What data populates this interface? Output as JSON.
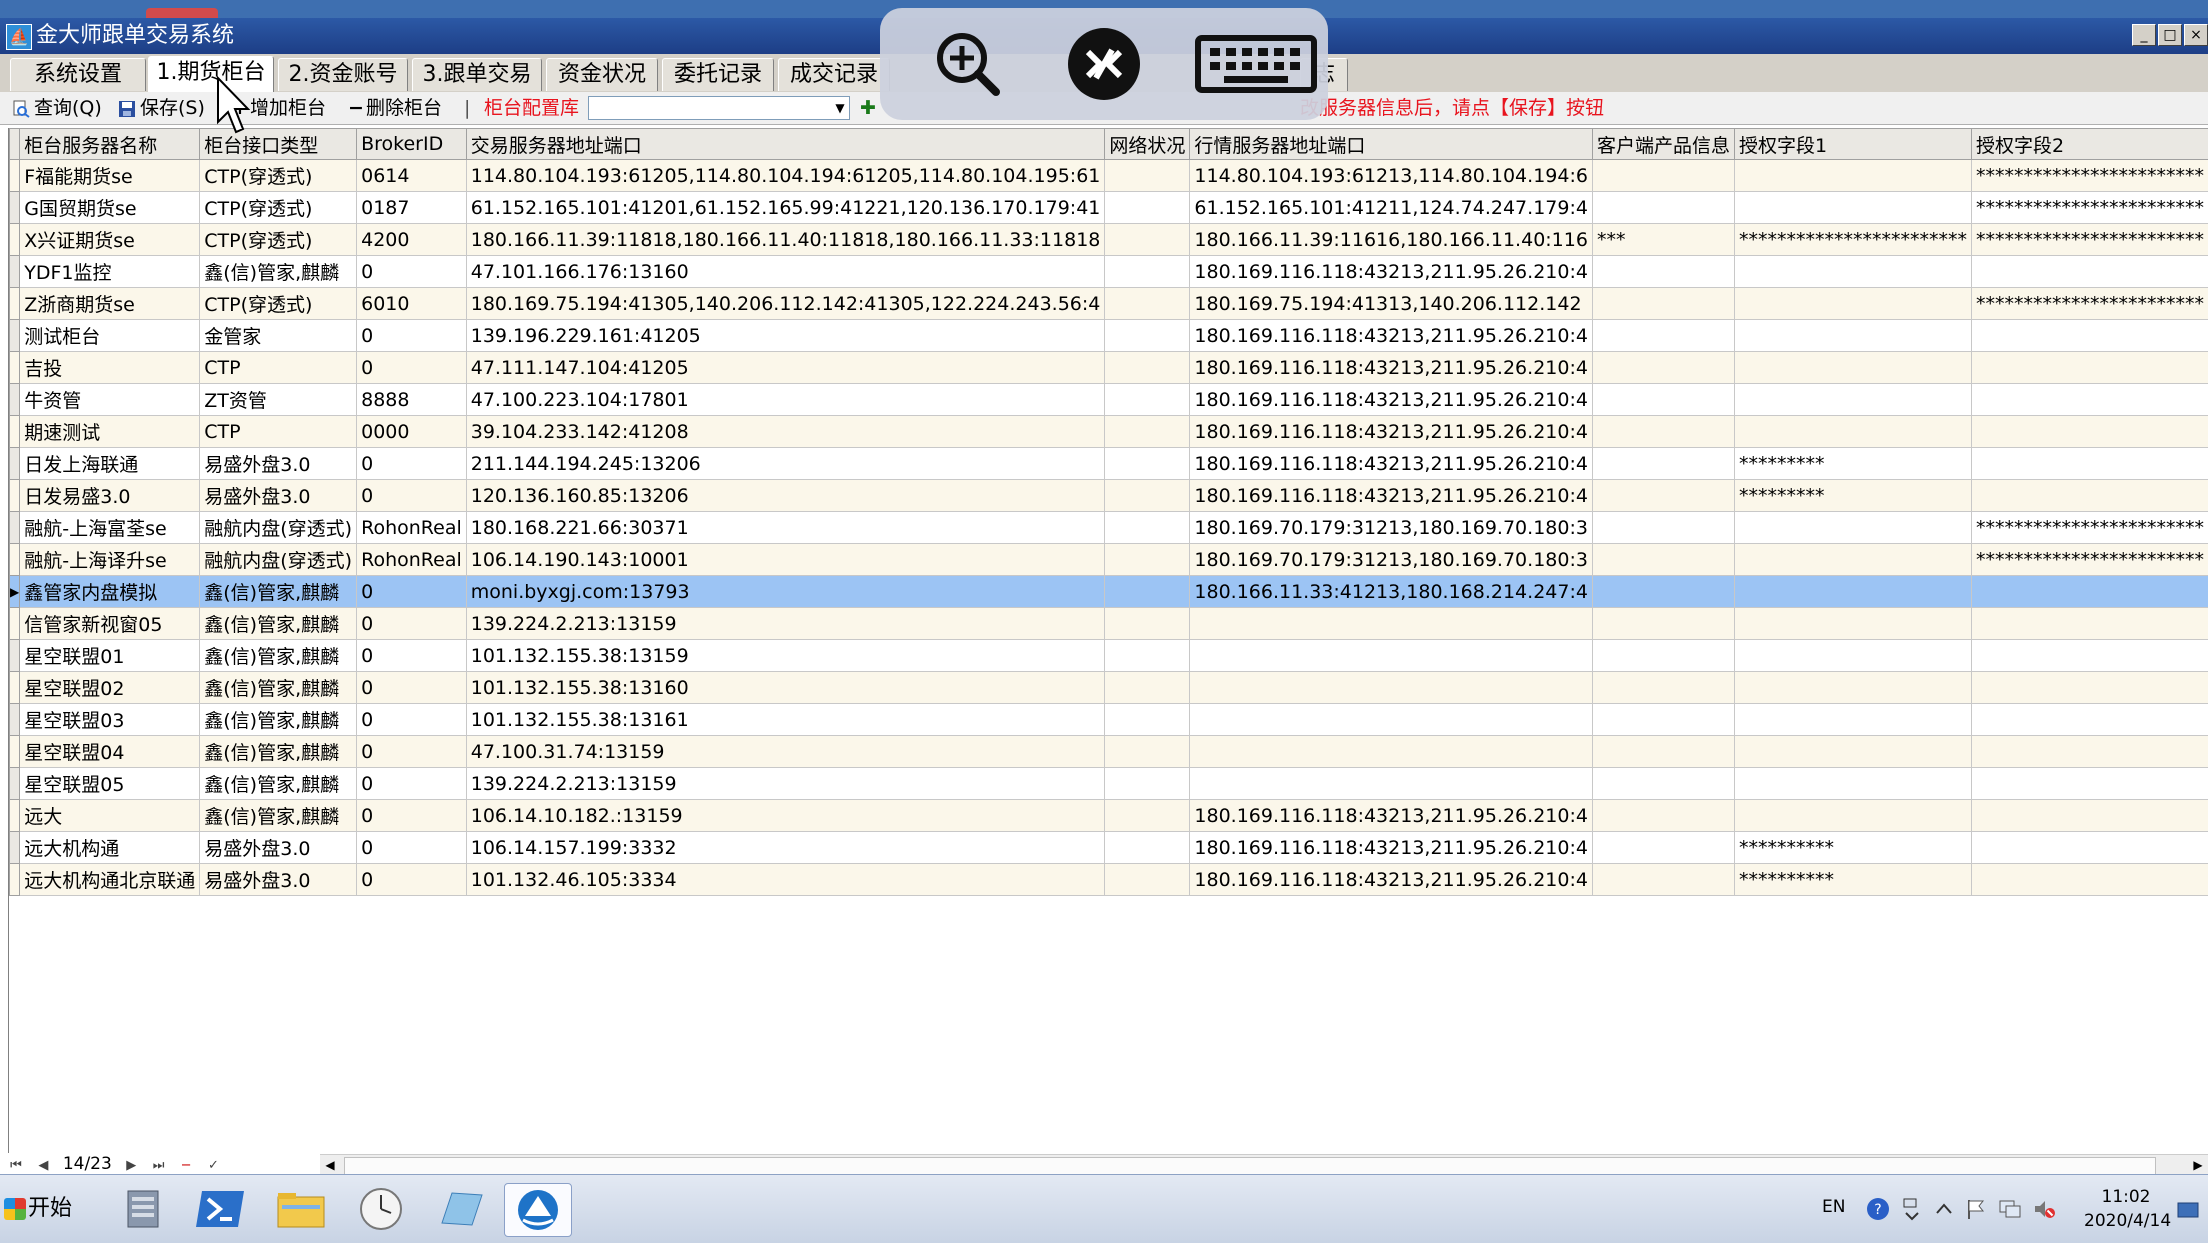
{
  "window": {
    "title": "金大师跟单交易系统",
    "buttons": [
      "_",
      "□",
      "×"
    ]
  },
  "tabs": [
    {
      "label": "系统设置",
      "active": false
    },
    {
      "label": "1.期货柜台",
      "active": true
    },
    {
      "label": "2.资金账号",
      "active": false
    },
    {
      "label": "3.跟单交易",
      "active": false
    },
    {
      "label": "资金状况",
      "active": false
    },
    {
      "label": "委托记录",
      "active": false
    },
    {
      "label": "成交记录",
      "active": false
    },
    {
      "label": "志",
      "active": false
    }
  ],
  "toolbar": {
    "query_label": "查询(Q)",
    "save_label": "保存(S)",
    "add_label": "增加柜台",
    "delete_label": "删除柜台",
    "config_label": "柜台配置库",
    "combo_value": "",
    "hint": "改服务器信息后，请点【保存】按钮"
  },
  "table": {
    "columns": [
      "柜台服务器名称",
      "柜台接口类型",
      "BrokerID",
      "交易服务器地址端口",
      "网络状况",
      "行情服务器地址端口",
      "客户端产品信息",
      "授权字段1",
      "授权字段2"
    ],
    "rows": [
      [
        "F福能期货se",
        "CTP(穿透式)",
        "0614",
        "114.80.104.193:61205,114.80.104.194:61205,114.80.104.195:61",
        "",
        "114.80.104.193:61213,114.80.104.194:6",
        "",
        "",
        "************************"
      ],
      [
        "G国贸期货se",
        "CTP(穿透式)",
        "0187",
        "61.152.165.101:41201,61.152.165.99:41221,120.136.170.179:41",
        "",
        "61.152.165.101:41211,124.74.247.179:4",
        "",
        "",
        "************************"
      ],
      [
        "X兴证期货se",
        "CTP(穿透式)",
        "4200",
        "180.166.11.39:11818,180.166.11.40:11818,180.166.11.33:11818",
        "",
        "180.166.11.39:11616,180.166.11.40:116",
        "***",
        "************************",
        "************************"
      ],
      [
        "YDF1监控",
        "鑫(信)管家,麒麟",
        "0",
        "47.101.166.176:13160",
        "",
        "180.169.116.118:43213,211.95.26.210:4",
        "",
        "",
        ""
      ],
      [
        "Z浙商期货se",
        "CTP(穿透式)",
        "6010",
        "180.169.75.194:41305,140.206.112.142:41305,122.224.243.56:4",
        "",
        "180.169.75.194:41313,140.206.112.142",
        "",
        "",
        "************************"
      ],
      [
        "测试柜台",
        "金管家",
        "0",
        "139.196.229.161:41205",
        "",
        "180.169.116.118:43213,211.95.26.210:4",
        "",
        "",
        ""
      ],
      [
        "吉投",
        "CTP",
        "0",
        "47.111.147.104:41205",
        "",
        "180.169.116.118:43213,211.95.26.210:4",
        "",
        "",
        ""
      ],
      [
        "牛资管",
        "ZT资管",
        "8888",
        "47.100.223.104:17801",
        "",
        "180.169.116.118:43213,211.95.26.210:4",
        "",
        "",
        ""
      ],
      [
        "期速测试",
        "CTP",
        "0000",
        "39.104.233.142:41208",
        "",
        "180.169.116.118:43213,211.95.26.210:4",
        "",
        "",
        ""
      ],
      [
        "日发上海联通",
        "易盛外盘3.0",
        "0",
        "211.144.194.245:13206",
        "",
        "180.169.116.118:43213,211.95.26.210:4",
        "",
        "*********",
        ""
      ],
      [
        "日发易盛3.0",
        "易盛外盘3.0",
        "0",
        "120.136.160.85:13206",
        "",
        "180.169.116.118:43213,211.95.26.210:4",
        "",
        "*********",
        ""
      ],
      [
        "融航-上海富荃se",
        "融航内盘(穿透式)",
        "RohonReal",
        "180.168.221.66:30371",
        "",
        "180.169.70.179:31213,180.169.70.180:3",
        "",
        "",
        "************************"
      ],
      [
        "融航-上海译升se",
        "融航内盘(穿透式)",
        "RohonReal",
        "106.14.190.143:10001",
        "",
        "180.169.70.179:31213,180.169.70.180:3",
        "",
        "",
        "************************"
      ],
      [
        "鑫管家内盘模拟",
        "鑫(信)管家,麒麟",
        "0",
        "moni.byxgj.com:13793",
        "",
        "180.166.11.33:41213,180.168.214.247:4",
        "",
        "",
        ""
      ],
      [
        "信管家新视窗05",
        "鑫(信)管家,麒麟",
        "0",
        "139.224.2.213:13159",
        "",
        "",
        "",
        "",
        ""
      ],
      [
        "星空联盟01",
        "鑫(信)管家,麒麟",
        "0",
        "101.132.155.38:13159",
        "",
        "",
        "",
        "",
        ""
      ],
      [
        "星空联盟02",
        "鑫(信)管家,麒麟",
        "0",
        "101.132.155.38:13160",
        "",
        "",
        "",
        "",
        ""
      ],
      [
        "星空联盟03",
        "鑫(信)管家,麒麟",
        "0",
        "101.132.155.38:13161",
        "",
        "",
        "",
        "",
        ""
      ],
      [
        "星空联盟04",
        "鑫(信)管家,麒麟",
        "0",
        "47.100.31.74:13159",
        "",
        "",
        "",
        "",
        ""
      ],
      [
        "星空联盟05",
        "鑫(信)管家,麒麟",
        "0",
        "139.224.2.213:13159",
        "",
        "",
        "",
        "",
        ""
      ],
      [
        "远大",
        "鑫(信)管家,麒麟",
        "0",
        "106.14.10.182.:13159",
        "",
        "180.169.116.118:43213,211.95.26.210:4",
        "",
        "",
        ""
      ],
      [
        "远大机构通",
        "易盛外盘3.0",
        "0",
        "106.14.157.199:3332",
        "",
        "180.169.116.118:43213,211.95.26.210:4",
        "",
        "**********",
        ""
      ],
      [
        "远大机构通北京联通",
        "易盛外盘3.0",
        "0",
        "101.132.46.105:3334",
        "",
        "180.169.116.118:43213,211.95.26.210:4",
        "",
        "**********",
        ""
      ]
    ],
    "selected_row": 13,
    "current_row_marker": "▶"
  },
  "navigator": {
    "position": "14/23",
    "first": "⏮",
    "prev": "◀",
    "next": "▶",
    "last": "⏭",
    "delete": "−",
    "post": "✓"
  },
  "overlay_icons": [
    "zoom-in-icon",
    "remote-desktop-icon",
    "keyboard-icon"
  ],
  "taskbar": {
    "start_label": "开始",
    "lang": "EN",
    "time": "11:02",
    "date": "2020/4/14"
  },
  "colors": {
    "title_bar": "#2c59a6",
    "selected_row": "#9cc4f4",
    "alt_row": "#fbf7ea",
    "hint_red": "#e8141e"
  }
}
